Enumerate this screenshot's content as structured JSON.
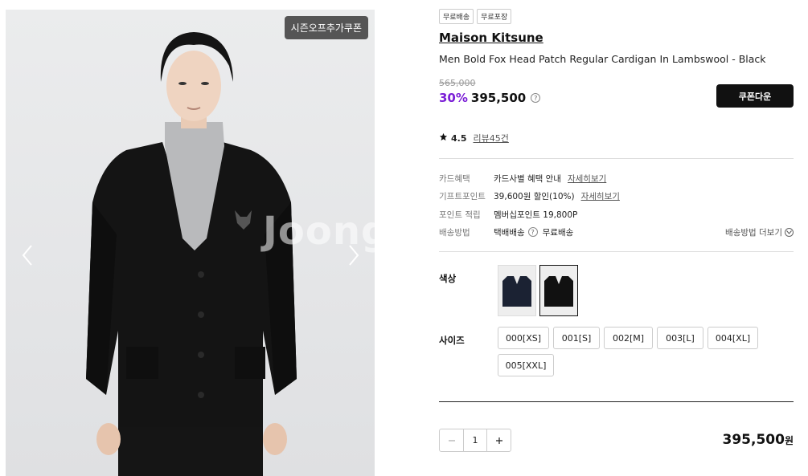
{
  "gallery": {
    "coupon_tag": "시즌오프추가쿠폰",
    "watermark": "Joong"
  },
  "product": {
    "badges": [
      "무료배송",
      "무료포장"
    ],
    "brand": "Maison Kitsune",
    "name": "Men Bold Fox Head Patch Regular Cardigan In Lambswool - Black",
    "original_price": "565,000",
    "discount": "30%",
    "price": "395,500",
    "coupon_button": "쿠폰다운",
    "rating": "4.5",
    "reviews": "리뷰45건"
  },
  "benefits": {
    "card_label": "카드혜택",
    "card_value": "카드사별 혜택 안내",
    "card_link": "자세히보기",
    "gift_label": "기프트포인트",
    "gift_value": "39,600원 할인(10%)",
    "gift_link": "자세히보기",
    "point_label": "포인트 적립",
    "point_value": "멤버십포인트 19,800P",
    "ship_label": "배송방법",
    "ship_method": "택배배송",
    "ship_fee": "무료배송",
    "ship_more": "배송방법 더보기"
  },
  "options": {
    "color_label": "색상",
    "size_label": "사이즈",
    "sizes": [
      "000[XS]",
      "001[S]",
      "002[M]",
      "003[L]",
      "004[XL]",
      "005[XXL]"
    ]
  },
  "order": {
    "quantity": "1",
    "total": "395,500",
    "currency": "원"
  },
  "colors": {
    "discount": "#7b1fd6",
    "button": "#111111"
  },
  "icons": {
    "prev": "chevron-left-icon",
    "next": "chevron-right-icon",
    "star": "star-icon",
    "help": "question-circle-icon",
    "expand": "chevron-down-icon",
    "minus": "minus-icon",
    "plus": "plus-icon"
  }
}
